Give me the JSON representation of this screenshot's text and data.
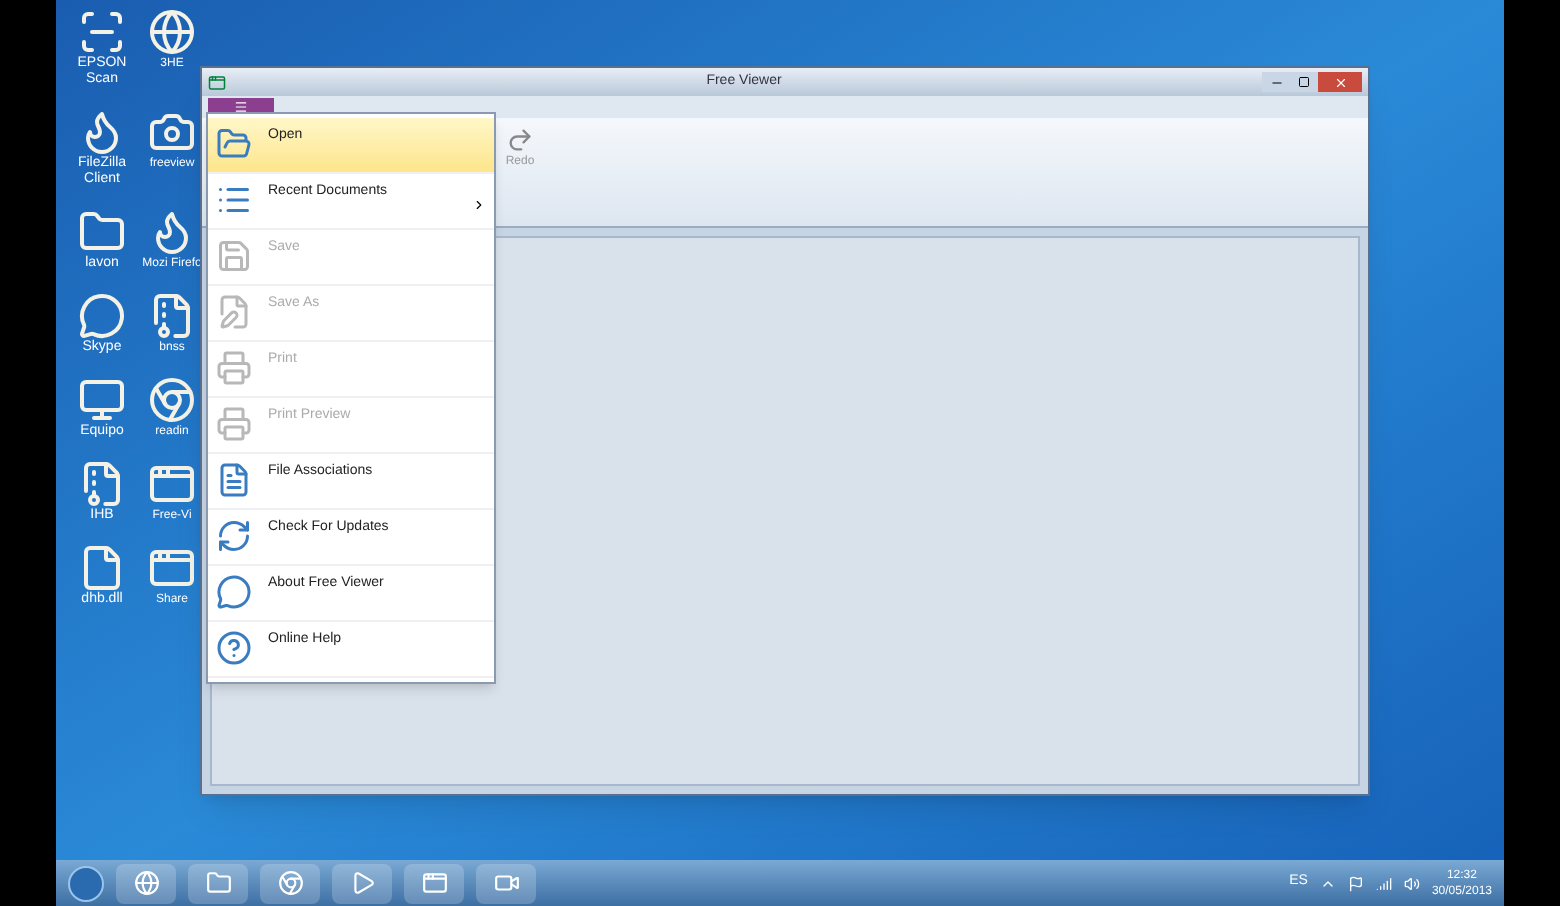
{
  "desktop_icons": [
    {
      "label": "EPSON Scan",
      "kind": "scanner"
    },
    {
      "label": "3HE",
      "kind": "globe"
    },
    {
      "label": "FileZilla Client",
      "kind": "filezilla"
    },
    {
      "label": "freeview",
      "kind": "camera"
    },
    {
      "label": "lavon",
      "kind": "folder"
    },
    {
      "label": "Mozi Firefo",
      "kind": "firefox"
    },
    {
      "label": "Skype",
      "kind": "skype"
    },
    {
      "label": "bnss",
      "kind": "zip"
    },
    {
      "label": "Equipo",
      "kind": "computer"
    },
    {
      "label": "readin",
      "kind": "chrome"
    },
    {
      "label": "IHB",
      "kind": "zip"
    },
    {
      "label": "Free-Vi",
      "kind": "app"
    },
    {
      "label": "dhb.dll",
      "kind": "file"
    },
    {
      "label": "Share",
      "kind": "app"
    }
  ],
  "window": {
    "title": "Free Viewer",
    "ribbon_button": "Redo"
  },
  "app_menu": [
    {
      "label": "Open",
      "kind": "open",
      "selected": true,
      "disabled": false,
      "submenu": false
    },
    {
      "label": "Recent Documents",
      "kind": "list",
      "selected": false,
      "disabled": false,
      "submenu": true
    },
    {
      "label": "Save",
      "kind": "save",
      "selected": false,
      "disabled": true,
      "submenu": false
    },
    {
      "label": "Save As",
      "kind": "saveas",
      "selected": false,
      "disabled": true,
      "submenu": false
    },
    {
      "label": "Print",
      "kind": "print",
      "selected": false,
      "disabled": true,
      "submenu": false
    },
    {
      "label": "Print Preview",
      "kind": "print",
      "selected": false,
      "disabled": true,
      "submenu": false
    },
    {
      "label": "File Associations",
      "kind": "assoc",
      "selected": false,
      "disabled": false,
      "submenu": false
    },
    {
      "label": "Check For Updates",
      "kind": "update",
      "selected": false,
      "disabled": false,
      "submenu": false
    },
    {
      "label": "About Free Viewer",
      "kind": "about",
      "selected": false,
      "disabled": false,
      "submenu": false
    },
    {
      "label": "Online Help",
      "kind": "help",
      "selected": false,
      "disabled": false,
      "submenu": false
    }
  ],
  "taskbar": {
    "apps": [
      {
        "kind": "ie"
      },
      {
        "kind": "folder"
      },
      {
        "kind": "chrome"
      },
      {
        "kind": "media"
      },
      {
        "kind": "viewer"
      },
      {
        "kind": "camera"
      }
    ],
    "language": "ES",
    "time": "12:32",
    "date": "30/05/2013"
  }
}
